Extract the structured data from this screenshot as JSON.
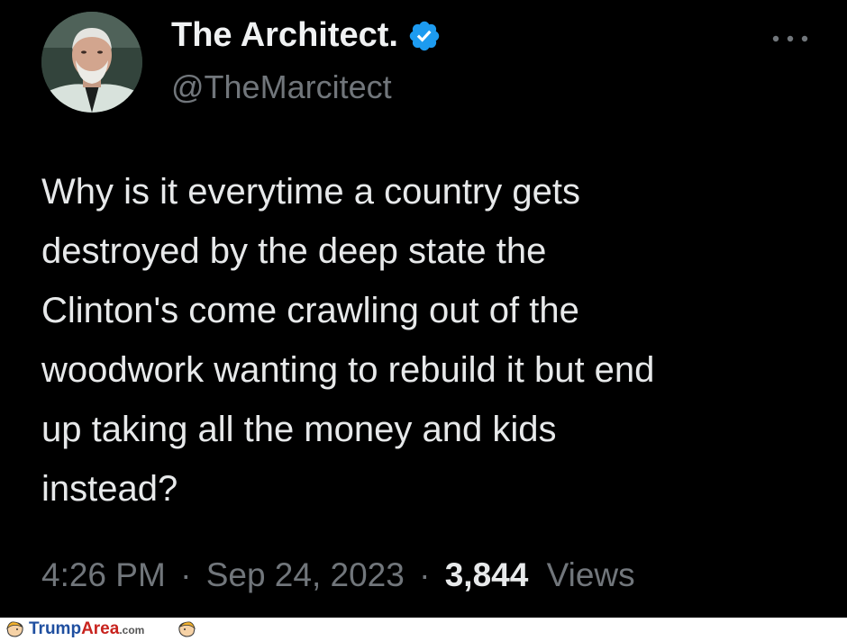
{
  "tweet": {
    "display_name": "The Architect.",
    "handle": "@TheMarcitect",
    "verified_icon": "verified-badge-icon",
    "more_icon": "more-horizontal-icon",
    "text_lines": [
      "Why is it everytime a country gets",
      "destroyed by the deep state the",
      "Clinton's come crawling out of the",
      "woodwork wanting to rebuild it but end",
      "up taking all the money and kids",
      "instead?"
    ],
    "time": "4:26 PM",
    "separator": "·",
    "date": "Sep 24, 2023",
    "views_count": "3,844",
    "views_label": "Views"
  },
  "watermark": {
    "brand_part1": "Trump",
    "brand_part2": "Area",
    "brand_suffix": ".com",
    "icon": "trump-caricature-icon"
  },
  "colors": {
    "background": "#000000",
    "text": "#e7e9ea",
    "muted": "#71767b",
    "verified": "#1d9bf0"
  }
}
